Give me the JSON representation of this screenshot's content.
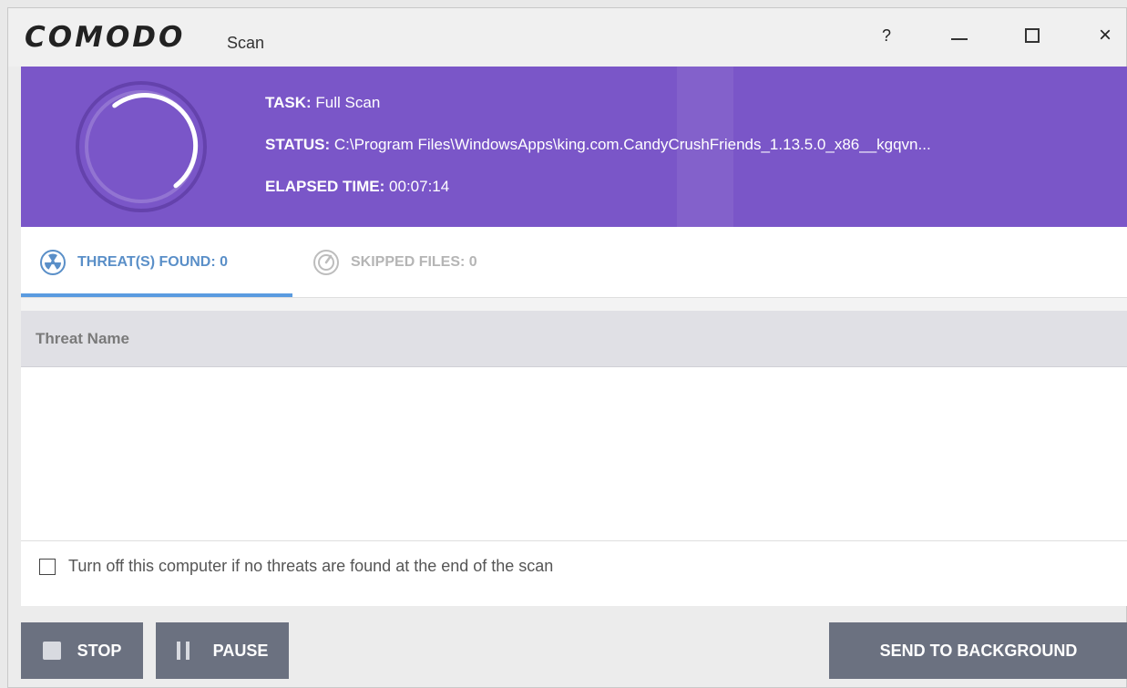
{
  "window": {
    "brand": "COMODO",
    "subtitle": "Scan",
    "controls": {
      "help": "?",
      "minimize": "minimize-icon",
      "maximize": "maximize-icon",
      "close": "×"
    }
  },
  "banner": {
    "color": "#7a56c8",
    "task_label": "TASK:",
    "task_value": "Full Scan",
    "status_label": "STATUS:",
    "status_value": "C:\\Program Files\\WindowsApps\\king.com.CandyCrushFriends_1.13.5.0_x86__kgqvn...",
    "elapsed_label": "ELAPSED TIME:",
    "elapsed_value": "00:07:14"
  },
  "tabs": [
    {
      "label": "THREAT(S) FOUND: 0",
      "icon": "radiation-icon",
      "active": true
    },
    {
      "label": "SKIPPED FILES: 0",
      "icon": "skip-icon",
      "active": false
    }
  ],
  "table": {
    "columns": [
      "Threat Name"
    ],
    "rows": []
  },
  "options": {
    "shutdown_label": "Turn off this computer if no threats are found at the end of the scan",
    "shutdown_checked": false
  },
  "buttons": {
    "stop": "STOP",
    "pause": "PAUSE",
    "send_to_background": "SEND TO BACKGROUND"
  }
}
